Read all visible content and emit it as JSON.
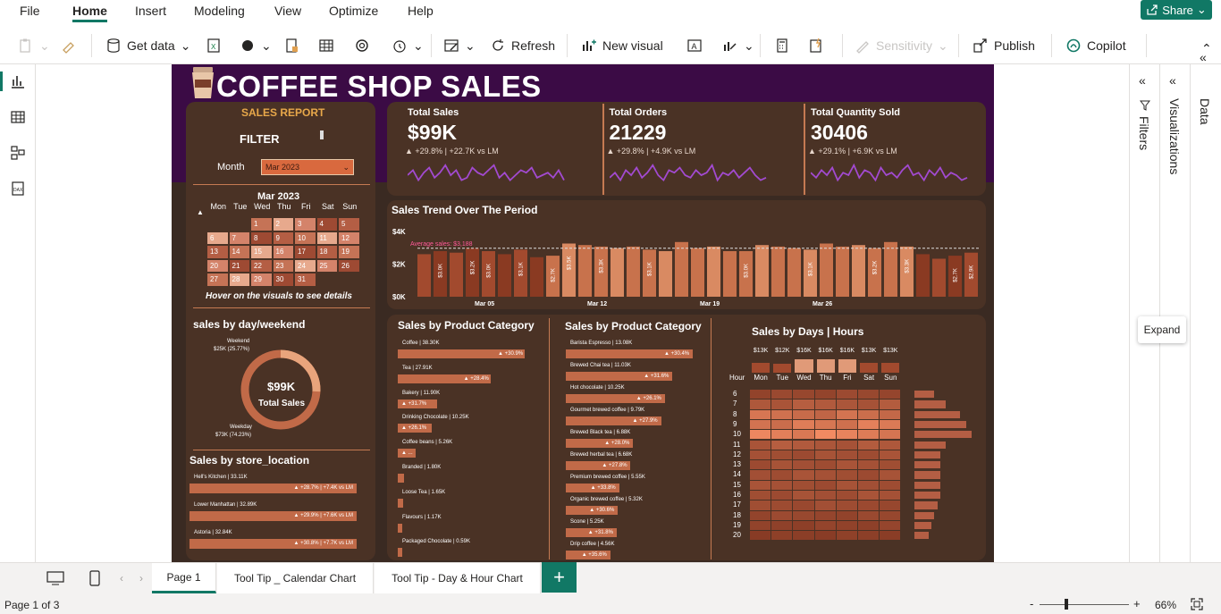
{
  "menu": [
    "File",
    "Home",
    "Insert",
    "Modeling",
    "View",
    "Optimize",
    "Help"
  ],
  "share_label": "Share",
  "ribbon": {
    "get_data": "Get data",
    "refresh": "Refresh",
    "new_visual": "New visual",
    "sensitivity": "Sensitivity",
    "publish": "Publish",
    "copilot": "Copilot"
  },
  "report": {
    "title": "COFFEE SHOP SALES",
    "sales_report": "SALES REPORT",
    "filter": "FILTER",
    "month_label": "Month",
    "month_value": "Mar 2023",
    "calendar": {
      "title": "Mar 2023",
      "days": [
        "Mon",
        "Tue",
        "Wed",
        "Thu",
        "Fri",
        "Sat",
        "Sun"
      ],
      "weeks": [
        [
          "",
          "",
          "1",
          "2",
          "3",
          "4",
          "5"
        ],
        [
          "6",
          "7",
          "8",
          "9",
          "10",
          "11",
          "12"
        ],
        [
          "13",
          "14",
          "15",
          "16",
          "17",
          "18",
          "19"
        ],
        [
          "20",
          "21",
          "22",
          "23",
          "24",
          "25",
          "26"
        ],
        [
          "27",
          "28",
          "29",
          "30",
          "31",
          "",
          ""
        ]
      ],
      "hint": "Hover on the visuals to see details"
    },
    "kpis": [
      {
        "title": "Total Sales",
        "value": "$99K",
        "delta": "+29.8% | +22.7K vs LM"
      },
      {
        "title": "Total Orders",
        "value": "21229",
        "delta": "+29.8% | +4.9K vs LM"
      },
      {
        "title": "Total Quantity Sold",
        "value": "30406",
        "delta": "+29.1% | +6.9K vs LM"
      }
    ],
    "trend": {
      "title": "Sales Trend Over The Period",
      "avg_label": "Average sales: $3,188",
      "y_ticks": [
        "$4K",
        "$2K",
        "$0K"
      ],
      "x_ticks": [
        "Mar 05",
        "Mar 12",
        "Mar 19",
        "Mar 26"
      ]
    },
    "weekend": {
      "title": "sales by day/weekend",
      "weekend_label": "Weekend",
      "weekend_value": "$25K (25.77%)",
      "weekday_label": "Weekday",
      "weekday_value": "$73K (74.23%)",
      "center_value": "$99K",
      "center_label": "Total Sales"
    },
    "store": {
      "title": "Sales by store_location",
      "items": [
        {
          "label": "Hell's Kitchen | 33.11K",
          "delta": "+28.7% | +7.4K vs LM"
        },
        {
          "label": "Lower Manhattan | 32.89K",
          "delta": "+29.9% | +7.6K vs LM"
        },
        {
          "label": "Astoria | 32.84K",
          "delta": "+30.8% | +7.7K vs LM"
        }
      ]
    },
    "category": {
      "title": "Sales by Product Category",
      "items": [
        {
          "label": "Coffee | 38.30K",
          "delta": "+30.9%",
          "frac": 1.0
        },
        {
          "label": "Tea | 27.91K",
          "delta": "+28.4%",
          "frac": 0.73
        },
        {
          "label": "Bakery | 11.90K",
          "delta": "+31.7%",
          "frac": 0.31
        },
        {
          "label": "Drinking Chocolate | 10.25K",
          "delta": "+26.1%",
          "frac": 0.27
        },
        {
          "label": "Coffee beans | 5.26K",
          "delta": "...",
          "frac": 0.14
        },
        {
          "label": "Branded | 1.80K",
          "delta": "",
          "frac": 0.05
        },
        {
          "label": "Loose Tea | 1.65K",
          "delta": "",
          "frac": 0.04
        },
        {
          "label": "Flavours | 1.17K",
          "delta": "",
          "frac": 0.03
        },
        {
          "label": "Packaged Chocolate | 0.59K",
          "delta": "",
          "frac": 0.02
        }
      ]
    },
    "product": {
      "title": "Sales by Product Category",
      "items": [
        {
          "label": "Barista Espresso | 13.08K",
          "delta": "+30.4%",
          "frac": 1.0
        },
        {
          "label": "Brewed Chai tea | 11.03K",
          "delta": "+31.6%",
          "frac": 0.84
        },
        {
          "label": "Hot chocolate | 10.25K",
          "delta": "+26.1%",
          "frac": 0.78
        },
        {
          "label": "Gourmet brewed coffee | 9.79K",
          "delta": "+27.9%",
          "frac": 0.75
        },
        {
          "label": "Brewed Black tea | 6.88K",
          "delta": "+28.0%",
          "frac": 0.53
        },
        {
          "label": "Brewed herbal tea | 6.68K",
          "delta": "+27.8%",
          "frac": 0.51
        },
        {
          "label": "Premium brewed coffee | 5.55K",
          "delta": "+33.8%",
          "frac": 0.42
        },
        {
          "label": "Organic brewed coffee | 5.32K",
          "delta": "+30.6%",
          "frac": 0.41
        },
        {
          "label": "Scone | 5.25K",
          "delta": "+31.8%",
          "frac": 0.4
        },
        {
          "label": "Drip coffee | 4.56K",
          "delta": "+35.6%",
          "frac": 0.35
        }
      ]
    },
    "heatmap": {
      "title": "Sales by Days | Hours",
      "day_totals": [
        "$13K",
        "$12K",
        "$16K",
        "$16K",
        "$16K",
        "$13K",
        "$13K"
      ],
      "days": [
        "Mon",
        "Tue",
        "Wed",
        "Thu",
        "Fri",
        "Sat",
        "Sun"
      ],
      "hour_label": "Hour",
      "hours": [
        "6",
        "7",
        "8",
        "9",
        "10",
        "11",
        "12",
        "13",
        "14",
        "15",
        "16",
        "17",
        "18",
        "19",
        "20"
      ]
    }
  },
  "panes": {
    "filters": "Filters",
    "visualizations": "Visualizations",
    "data": "Data",
    "expand": "Expand"
  },
  "tabs": [
    "Page 1",
    "Tool Tip _ Calendar Chart",
    "Tool Tip - Day & Hour Chart"
  ],
  "add_tab": "+",
  "status": {
    "page": "Page 1 of 3",
    "zoom": "66%"
  }
}
